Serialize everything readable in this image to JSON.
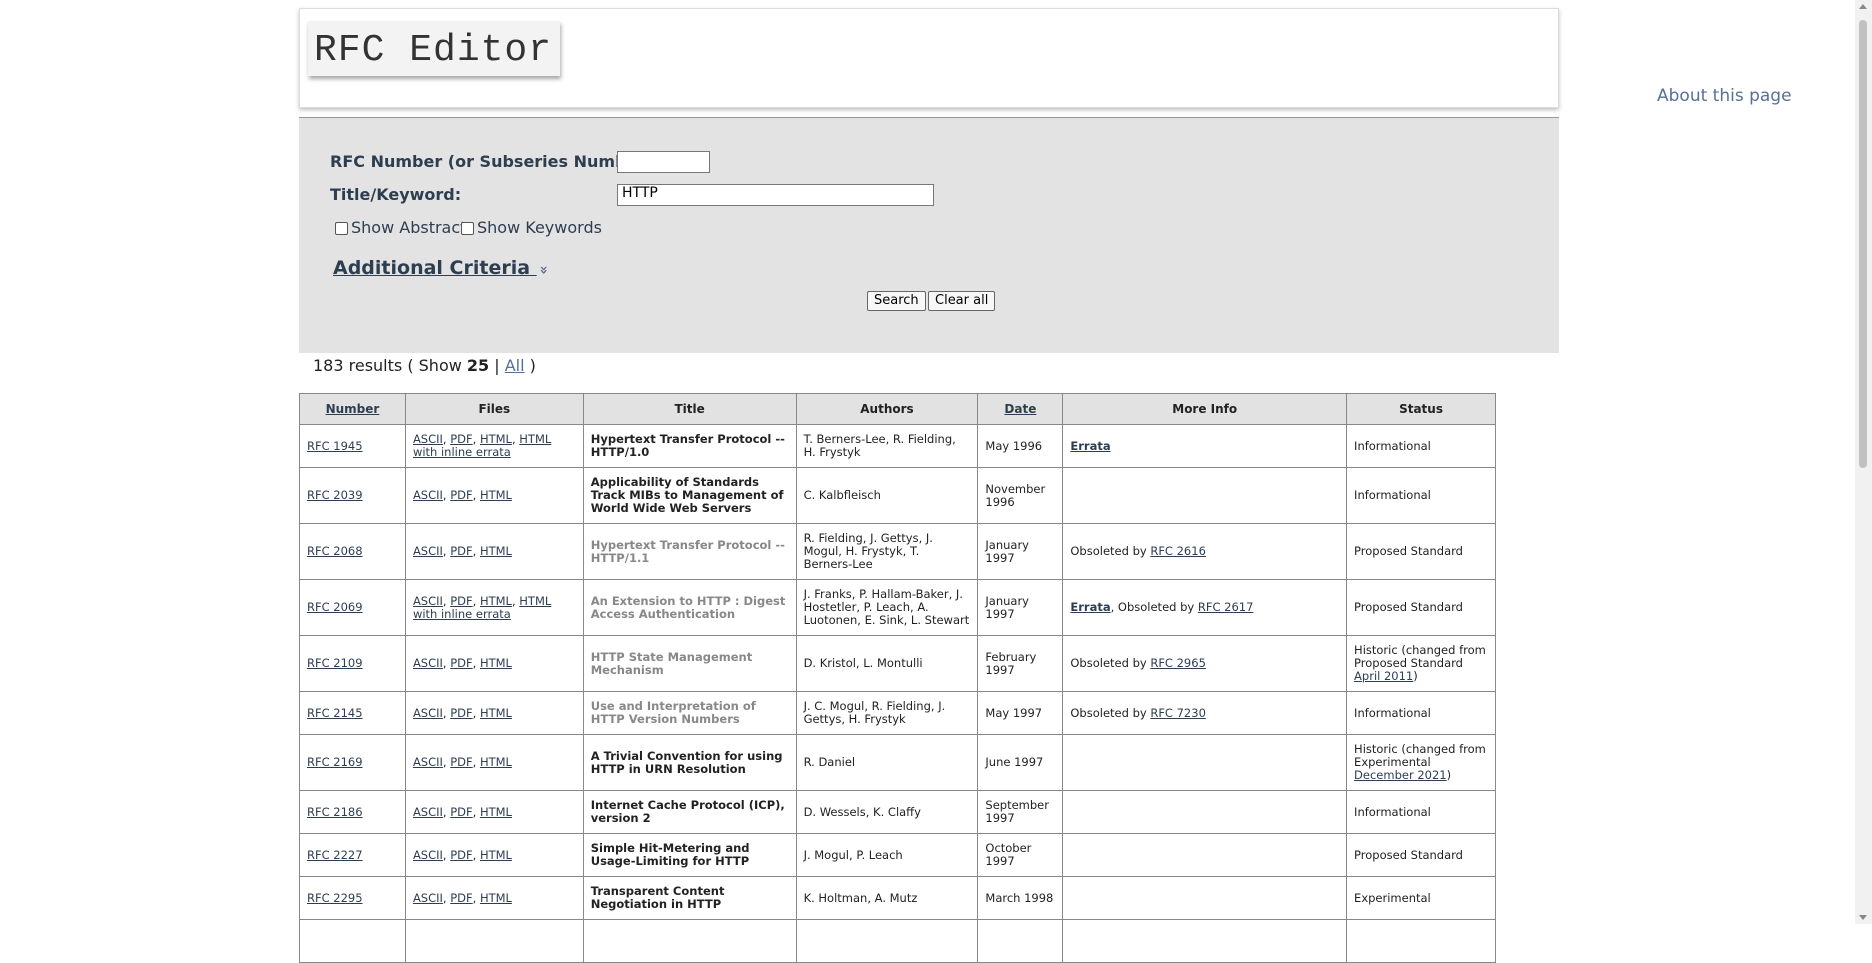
{
  "header": {
    "logo": "RFC Editor",
    "about": "About this page"
  },
  "search": {
    "rfc_number_label": "RFC Number (or Subseries Number):",
    "rfc_number_value": "",
    "keyword_label": "Title/Keyword:",
    "keyword_value": "HTTP",
    "show_abstract": "Show Abstract",
    "show_keywords": "Show Keywords",
    "additional_criteria": "Additional Criteria",
    "additional_icon": "»",
    "search_button": "Search",
    "clear_button": "Clear all"
  },
  "results": {
    "count_text": "183 results ( Show ",
    "show_count": "25",
    "sep": " | ",
    "all_link": "All",
    "close": " )"
  },
  "table": {
    "headers": {
      "number": "Number",
      "files": "Files",
      "title": "Title",
      "authors": "Authors",
      "date": "Date",
      "more_info": "More Info",
      "status": "Status"
    },
    "rows": [
      {
        "number": "RFC 1945",
        "files": [
          "ASCII",
          "PDF",
          "HTML",
          "HTML with inline errata"
        ],
        "title": "Hypertext Transfer Protocol -- HTTP/1.0",
        "obsolete": false,
        "authors": "T. Berners-Lee, R. Fielding, H. Frystyk",
        "date": "May 1996",
        "more_info": [
          {
            "t": "Errata",
            "link": true,
            "bold": true
          }
        ],
        "status": [
          {
            "t": "Informational"
          }
        ],
        "height": 43
      },
      {
        "number": "RFC 2039",
        "files": [
          "ASCII",
          "PDF",
          "HTML"
        ],
        "title": "Applicability of Standards Track MIBs to Management of World Wide Web Servers",
        "obsolete": false,
        "authors": "C. Kalbfleisch",
        "date": "November 1996",
        "more_info": [],
        "status": [
          {
            "t": "Informational"
          }
        ],
        "height": 56
      },
      {
        "number": "RFC 2068",
        "files": [
          "ASCII",
          "PDF",
          "HTML"
        ],
        "title": "Hypertext Transfer Protocol -- HTTP/1.1",
        "obsolete": true,
        "authors": "R. Fielding, J. Gettys, J. Mogul, H. Frystyk, T. Berners-Lee",
        "date": "January 1997",
        "more_info": [
          {
            "t": "Obsoleted by "
          },
          {
            "t": "RFC 2616",
            "link": true
          }
        ],
        "status": [
          {
            "t": "Proposed Standard"
          }
        ],
        "height": 56
      },
      {
        "number": "RFC 2069",
        "files": [
          "ASCII",
          "PDF",
          "HTML",
          "HTML with inline errata"
        ],
        "title": "An Extension to HTTP : Digest Access Authentication",
        "obsolete": true,
        "authors": "J. Franks, P. Hallam-Baker, J. Hostetler, P. Leach, A. Luotonen, E. Sink, L. Stewart",
        "date": "January 1997",
        "more_info": [
          {
            "t": "Errata",
            "link": true,
            "bold": true
          },
          {
            "t": ", Obsoleted by "
          },
          {
            "t": "RFC 2617",
            "link": true
          }
        ],
        "status": [
          {
            "t": "Proposed Standard"
          }
        ],
        "height": 56
      },
      {
        "number": "RFC 2109",
        "files": [
          "ASCII",
          "PDF",
          "HTML"
        ],
        "title": "HTTP State Management Mechanism",
        "obsolete": true,
        "authors": "D. Kristol, L. Montulli",
        "date": "February 1997",
        "more_info": [
          {
            "t": "Obsoleted by "
          },
          {
            "t": "RFC 2965",
            "link": true
          }
        ],
        "status": [
          {
            "t": "Historic (changed from Proposed Standard "
          },
          {
            "t": "April 2011",
            "link": true
          },
          {
            "t": ")"
          }
        ],
        "height": 56
      },
      {
        "number": "RFC 2145",
        "files": [
          "ASCII",
          "PDF",
          "HTML"
        ],
        "title": "Use and Interpretation of HTTP Version Numbers",
        "obsolete": true,
        "authors": "J. C. Mogul, R. Fielding, J. Gettys, H. Frystyk",
        "date": "May 1997",
        "more_info": [
          {
            "t": "Obsoleted by "
          },
          {
            "t": "RFC 7230",
            "link": true
          }
        ],
        "status": [
          {
            "t": "Informational"
          }
        ],
        "height": 43
      },
      {
        "number": "RFC 2169",
        "files": [
          "ASCII",
          "PDF",
          "HTML"
        ],
        "title": "A Trivial Convention for using HTTP in URN Resolution",
        "obsolete": false,
        "authors": "R. Daniel",
        "date": "June 1997",
        "more_info": [],
        "status": [
          {
            "t": "Historic (changed from Experimental "
          },
          {
            "t": "December 2021",
            "link": true
          },
          {
            "t": ")"
          }
        ],
        "height": 56
      },
      {
        "number": "RFC 2186",
        "files": [
          "ASCII",
          "PDF",
          "HTML"
        ],
        "title": "Internet Cache Protocol (ICP), version 2",
        "obsolete": false,
        "authors": "D. Wessels, K. Claffy",
        "date": "September 1997",
        "more_info": [],
        "status": [
          {
            "t": "Informational"
          }
        ],
        "height": 43
      },
      {
        "number": "RFC 2227",
        "files": [
          "ASCII",
          "PDF",
          "HTML"
        ],
        "title": "Simple Hit-Metering and Usage-Limiting for HTTP",
        "obsolete": false,
        "authors": "J. Mogul, P. Leach",
        "date": "October 1997",
        "more_info": [],
        "status": [
          {
            "t": "Proposed Standard"
          }
        ],
        "height": 43
      },
      {
        "number": "RFC 2295",
        "files": [
          "ASCII",
          "PDF",
          "HTML"
        ],
        "title": "Transparent Content Negotiation in HTTP",
        "obsolete": false,
        "authors": "K. Holtman, A. Mutz",
        "date": "March 1998",
        "more_info": [],
        "status": [
          {
            "t": "Experimental"
          }
        ],
        "height": 43
      },
      {
        "number": "",
        "files": [],
        "title": "",
        "obsolete": false,
        "authors": "",
        "date": "",
        "more_info": [],
        "status": [],
        "height": 43
      }
    ]
  }
}
